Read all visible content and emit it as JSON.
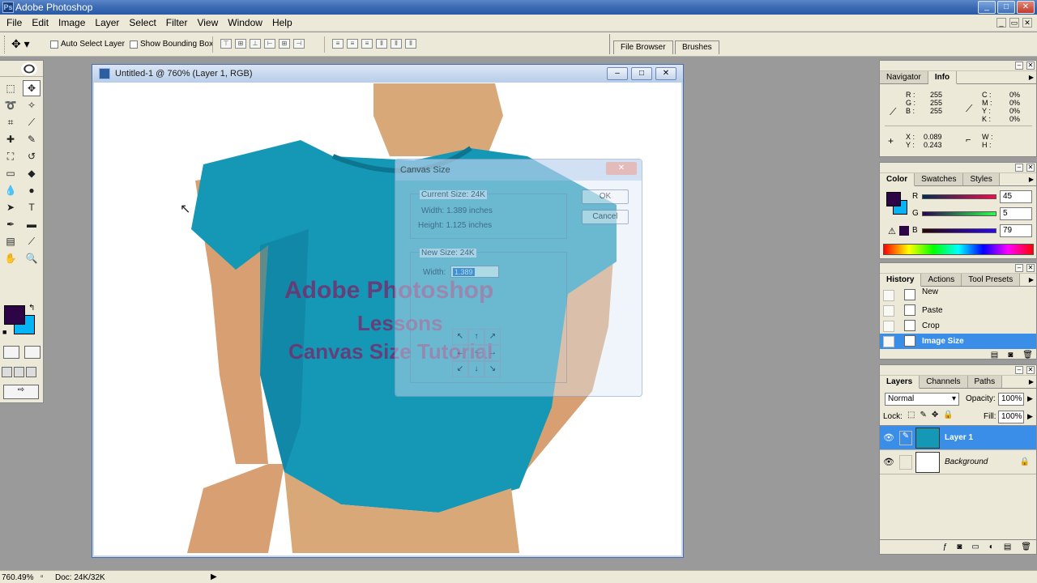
{
  "app": {
    "title": "Adobe Photoshop"
  },
  "menu": [
    "File",
    "Edit",
    "Image",
    "Layer",
    "Select",
    "Filter",
    "View",
    "Window",
    "Help"
  ],
  "options": {
    "auto_select": "Auto Select Layer",
    "bounding_box": "Show Bounding Box"
  },
  "well_tabs": [
    "File Browser",
    "Brushes"
  ],
  "document": {
    "title": "Untitled-1 @ 760% (Layer 1, RGB)"
  },
  "dialog": {
    "title": "Canvas Size",
    "current_size": "Current Size: 24K",
    "width": "Width: 1.389 inches",
    "height": "Height: 1.125 inches",
    "new_size": "New Size: 24K",
    "width_label": "Width:",
    "width_value": "1.389",
    "ok": "OK",
    "cancel": "Cancel"
  },
  "canvas_text": [
    "Adobe Photoshop",
    "Lessons",
    "Canvas Size Tutorial"
  ],
  "navigator": {
    "tabs": [
      "Navigator",
      "Info"
    ],
    "r_label": "R :",
    "r": "255",
    "g_label": "G :",
    "g": "255",
    "b_label": "B :",
    "b": "255",
    "c_label": "C :",
    "c": "0%",
    "m_label": "M :",
    "m": "0%",
    "y_label": "Y :",
    "y": "0%",
    "k_label": "K :",
    "k": "0%",
    "x_label": "X :",
    "x": "0.089",
    "yy_label": "Y :",
    "yy": "0.243",
    "w_label": "W :",
    "h_label": "H :"
  },
  "color": {
    "tabs": [
      "Color",
      "Swatches",
      "Styles"
    ],
    "r_label": "R",
    "r": "45",
    "g_label": "G",
    "g": "5",
    "b_label": "B",
    "b": "79",
    "foreground": "#2d0546",
    "background": "#05b4f5"
  },
  "history": {
    "tabs": [
      "History",
      "Actions",
      "Tool Presets"
    ],
    "items": [
      "New",
      "Paste",
      "Crop",
      "Image Size"
    ]
  },
  "layers": {
    "tabs": [
      "Layers",
      "Channels",
      "Paths"
    ],
    "blend_mode": "Normal",
    "opacity_label": "Opacity:",
    "opacity": "100%",
    "lock_label": "Lock:",
    "fill_label": "Fill:",
    "fill": "100%",
    "items": [
      "Layer 1",
      "Background"
    ]
  },
  "status": {
    "zoom": "760.49%",
    "doc": "Doc: 24K/32K"
  }
}
